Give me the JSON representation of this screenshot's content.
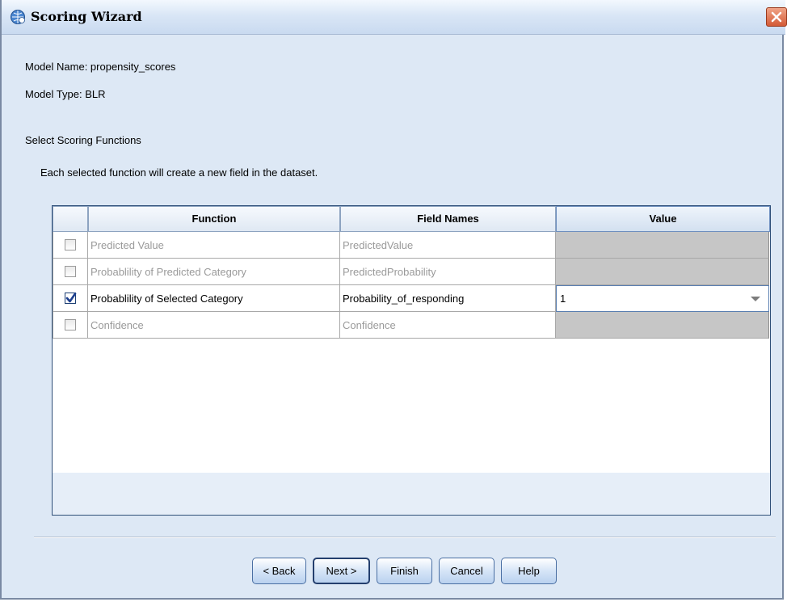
{
  "window": {
    "title": "Scoring Wizard"
  },
  "info": {
    "model_name": "Model Name: propensity_scores",
    "model_type": "Model Type: BLR"
  },
  "section": {
    "heading": "Select Scoring Functions",
    "description": "Each selected function will create a new field in the dataset."
  },
  "table": {
    "columns": {
      "function": "Function",
      "field_names": "Field Names",
      "value": "Value"
    },
    "rows": [
      {
        "checked": false,
        "enabled": false,
        "function": "Predicted Value",
        "field_name": "PredictedValue",
        "value": ""
      },
      {
        "checked": false,
        "enabled": false,
        "function": "Probablility of Predicted Category",
        "field_name": "PredictedProbability",
        "value": ""
      },
      {
        "checked": true,
        "enabled": true,
        "function": "Probablility of Selected Category",
        "field_name": "Probability_of_responding",
        "value": "1"
      },
      {
        "checked": false,
        "enabled": false,
        "function": "Confidence",
        "field_name": "Confidence",
        "value": ""
      }
    ]
  },
  "buttons": {
    "back": "< Back",
    "next": "Next >",
    "finish": "Finish",
    "cancel": "Cancel",
    "help": "Help"
  },
  "icons": {
    "title": "spss-globe-icon",
    "close": "close-icon",
    "check": "checkmark-icon",
    "dropdown": "chevron-down-icon"
  }
}
